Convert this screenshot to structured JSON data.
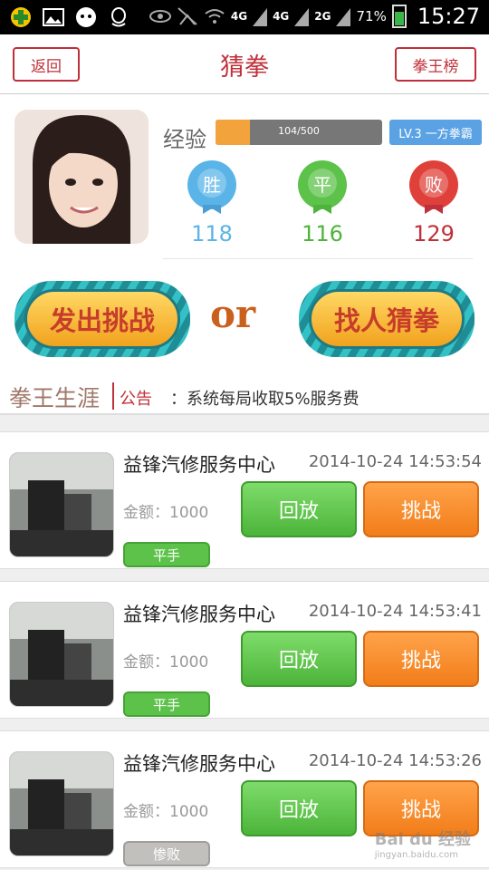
{
  "status_bar": {
    "network_1": "4G",
    "network_2": "4G",
    "network_3": "2G",
    "battery": "71%",
    "time": "15:27"
  },
  "header": {
    "back_label": "返回",
    "title": "猜拳",
    "rank_label": "拳王榜"
  },
  "profile": {
    "exp_label": "经验",
    "exp_text": "104/500",
    "exp_fraction": 0.208,
    "level_badge": "LV.3 一方拳霸",
    "stats": {
      "win_icon_label": "胜",
      "win_count": "118",
      "draw_icon_label": "平",
      "draw_count": "116",
      "lose_icon_label": "败",
      "lose_count": "129"
    }
  },
  "actions": {
    "challenge_label": "发出挑战",
    "or_text": "or",
    "find_label": "找人猜拳"
  },
  "career": {
    "title": "拳王生涯",
    "notice_label": "公告",
    "notice_text": "：系统每局收取5%服务费"
  },
  "records": [
    {
      "name": "益锋汽修服务中心",
      "time": "2014-10-24 14:53:54",
      "amount": "金额：1000",
      "replay_label": "回放",
      "challenge_label": "挑战",
      "result": "平手"
    },
    {
      "name": "益锋汽修服务中心",
      "time": "2014-10-24 14:53:41",
      "amount": "金额：1000",
      "replay_label": "回放",
      "challenge_label": "挑战",
      "result": "平手"
    },
    {
      "name": "益锋汽修服务中心",
      "time": "2014-10-24 14:53:26",
      "amount": "金额：1000",
      "replay_label": "回放",
      "challenge_label": "挑战",
      "result": "惨败"
    }
  ],
  "watermark": {
    "brand": "Bai du 经验",
    "url": "jingyan.baidu.com"
  },
  "colors": {
    "accent": "#c0303a",
    "win": "#5ab4e8",
    "draw": "#4cb43a",
    "lose": "#c0303a",
    "replay": "#5cc24a",
    "challenge": "#f27d1a"
  }
}
